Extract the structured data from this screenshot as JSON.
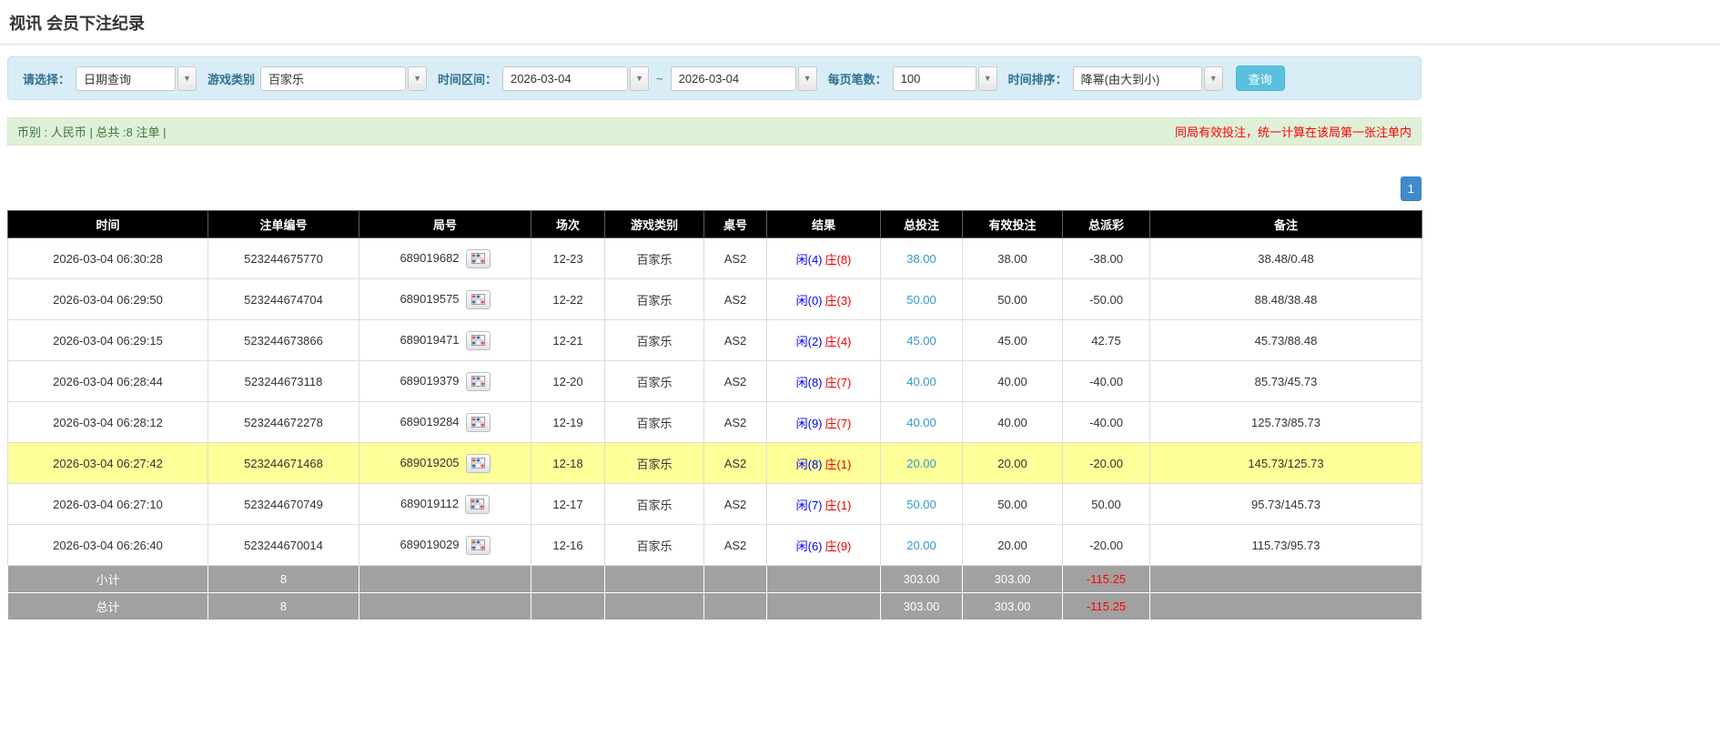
{
  "page": {
    "title": "视讯 会员下注纪录"
  },
  "filters": {
    "select_label": "请选择：",
    "select_value": "日期查询",
    "game_type_label": "游戏类别",
    "game_type_value": "百家乐",
    "time_range_label": "时间区间：",
    "date_from": "2026-03-04",
    "tilde": "~",
    "date_to": "2026-03-04",
    "page_size_label": "每页笔数：",
    "page_size_value": "100",
    "sort_label": "时间排序：",
    "sort_value": "降幂(由大到小)",
    "search_button": "查询"
  },
  "summary": {
    "left": "币别 : 人民币 | 总共 :8 注单 |",
    "right": "同局有效投注，统一计算在该局第一张注单内"
  },
  "pagination": {
    "current": "1"
  },
  "table": {
    "headers": [
      "时间",
      "注单编号",
      "局号",
      "场次",
      "游戏类别",
      "桌号",
      "结果",
      "总投注",
      "有效投注",
      "总派彩",
      "备注"
    ],
    "rows": [
      {
        "time": "2026-03-04 06:30:28",
        "bet_no": "523244675770",
        "round_no": "689019682",
        "session": "12-23",
        "game": "百家乐",
        "table_no": "AS2",
        "player": "闲(4)",
        "banker": "庄(8)",
        "total_bet": "38.00",
        "valid_bet": "38.00",
        "payout": "-38.00",
        "note": "38.48/0.48",
        "highlight": false
      },
      {
        "time": "2026-03-04 06:29:50",
        "bet_no": "523244674704",
        "round_no": "689019575",
        "session": "12-22",
        "game": "百家乐",
        "table_no": "AS2",
        "player": "闲(0)",
        "banker": "庄(3)",
        "total_bet": "50.00",
        "valid_bet": "50.00",
        "payout": "-50.00",
        "note": "88.48/38.48",
        "highlight": false
      },
      {
        "time": "2026-03-04 06:29:15",
        "bet_no": "523244673866",
        "round_no": "689019471",
        "session": "12-21",
        "game": "百家乐",
        "table_no": "AS2",
        "player": "闲(2)",
        "banker": "庄(4)",
        "total_bet": "45.00",
        "valid_bet": "45.00",
        "payout": "42.75",
        "note": "45.73/88.48",
        "highlight": false
      },
      {
        "time": "2026-03-04 06:28:44",
        "bet_no": "523244673118",
        "round_no": "689019379",
        "session": "12-20",
        "game": "百家乐",
        "table_no": "AS2",
        "player": "闲(8)",
        "banker": "庄(7)",
        "total_bet": "40.00",
        "valid_bet": "40.00",
        "payout": "-40.00",
        "note": "85.73/45.73",
        "highlight": false
      },
      {
        "time": "2026-03-04 06:28:12",
        "bet_no": "523244672278",
        "round_no": "689019284",
        "session": "12-19",
        "game": "百家乐",
        "table_no": "AS2",
        "player": "闲(9)",
        "banker": "庄(7)",
        "total_bet": "40.00",
        "valid_bet": "40.00",
        "payout": "-40.00",
        "note": "125.73/85.73",
        "highlight": false
      },
      {
        "time": "2026-03-04 06:27:42",
        "bet_no": "523244671468",
        "round_no": "689019205",
        "session": "12-18",
        "game": "百家乐",
        "table_no": "AS2",
        "player": "闲(8)",
        "banker": "庄(1)",
        "total_bet": "20.00",
        "valid_bet": "20.00",
        "payout": "-20.00",
        "note": "145.73/125.73",
        "highlight": true
      },
      {
        "time": "2026-03-04 06:27:10",
        "bet_no": "523244670749",
        "round_no": "689019112",
        "session": "12-17",
        "game": "百家乐",
        "table_no": "AS2",
        "player": "闲(7)",
        "banker": "庄(1)",
        "total_bet": "50.00",
        "valid_bet": "50.00",
        "payout": "50.00",
        "note": "95.73/145.73",
        "highlight": false
      },
      {
        "time": "2026-03-04 06:26:40",
        "bet_no": "523244670014",
        "round_no": "689019029",
        "session": "12-16",
        "game": "百家乐",
        "table_no": "AS2",
        "player": "闲(6)",
        "banker": "庄(9)",
        "total_bet": "20.00",
        "valid_bet": "20.00",
        "payout": "-20.00",
        "note": "115.73/95.73",
        "highlight": false
      }
    ],
    "subtotal": {
      "label": "小计",
      "count": "8",
      "total_bet": "303.00",
      "valid_bet": "303.00",
      "payout": "-115.25"
    },
    "total": {
      "label": "总计",
      "count": "8",
      "total_bet": "303.00",
      "valid_bet": "303.00",
      "payout": "-115.25"
    }
  },
  "colors": {
    "accent_blue": "#428bca",
    "info_bg": "#d9edf7",
    "success_bg": "#dff0d8",
    "highlight_yellow": "#ffff99",
    "negative_red": "#ff0000",
    "player_blue": "#0000ee",
    "banker_red": "#ee0000"
  }
}
